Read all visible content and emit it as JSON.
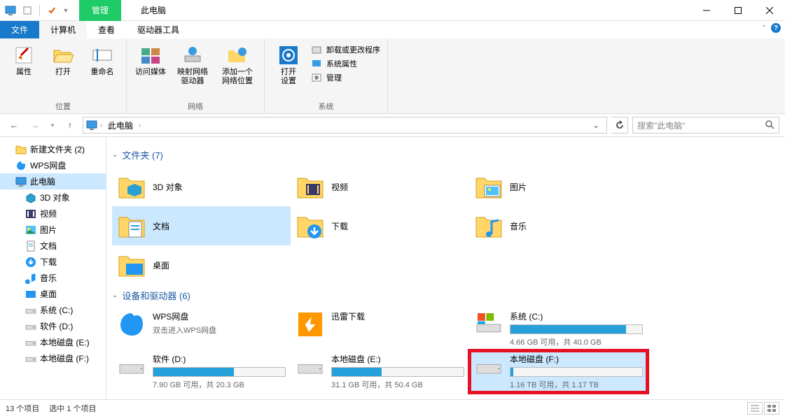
{
  "title": "此电脑",
  "context_tab": "管理",
  "ribbon_tabs": {
    "file": "文件",
    "computer": "计算机",
    "view": "查看",
    "tools": "驱动器工具"
  },
  "ribbon": {
    "group1": {
      "label": "位置",
      "properties": "属性",
      "open": "打开",
      "rename": "重命名"
    },
    "group2": {
      "label": "网络",
      "media": "访问媒体",
      "map": "映射网络\n驱动器",
      "addloc": "添加一个\n网络位置"
    },
    "group3": {
      "label": "系统",
      "settings": "打开\n设置",
      "uninstall": "卸载或更改程序",
      "sysprops": "系统属性",
      "manage": "管理"
    }
  },
  "nav": {
    "location": "此电脑",
    "search_ph": "搜索\"此电脑\""
  },
  "sidebar": {
    "items": [
      {
        "label": "新建文件夹 (2)",
        "icon": "folder"
      },
      {
        "label": "WPS网盘",
        "icon": "wps"
      },
      {
        "label": "此电脑",
        "icon": "pc",
        "selected": true
      },
      {
        "label": "3D 对象",
        "icon": "3d",
        "level": 2
      },
      {
        "label": "视频",
        "icon": "video",
        "level": 2
      },
      {
        "label": "图片",
        "icon": "pictures",
        "level": 2
      },
      {
        "label": "文档",
        "icon": "documents",
        "level": 2
      },
      {
        "label": "下载",
        "icon": "downloads",
        "level": 2
      },
      {
        "label": "音乐",
        "icon": "music",
        "level": 2
      },
      {
        "label": "桌面",
        "icon": "desktop",
        "level": 2
      },
      {
        "label": "系统 (C:)",
        "icon": "drive",
        "level": 2
      },
      {
        "label": "软件 (D:)",
        "icon": "drive",
        "level": 2
      },
      {
        "label": "本地磁盘 (E:)",
        "icon": "drive",
        "level": 2
      },
      {
        "label": "本地磁盘 (F:)",
        "icon": "drive",
        "level": 2
      }
    ]
  },
  "main": {
    "folders_header": "文件夹 (7)",
    "folders": [
      {
        "label": "3D 对象",
        "icon": "3d"
      },
      {
        "label": "视频",
        "icon": "video"
      },
      {
        "label": "图片",
        "icon": "pictures"
      },
      {
        "label": "文档",
        "icon": "documents",
        "selected": true
      },
      {
        "label": "下载",
        "icon": "downloads"
      },
      {
        "label": "音乐",
        "icon": "music"
      },
      {
        "label": "桌面",
        "icon": "desktop"
      }
    ],
    "drives_header": "设备和驱动器 (6)",
    "drives": [
      {
        "name": "WPS网盘",
        "sub": "双击进入WPS网盘",
        "icon": "wps",
        "no_bar": true
      },
      {
        "name": "迅雷下载",
        "sub": "",
        "icon": "xunlei",
        "no_bar": true
      },
      {
        "name": "系统 (C:)",
        "sub": "4.66 GB 可用，共 40.0 GB",
        "icon": "drive-win",
        "fill": 88
      },
      {
        "name": "软件 (D:)",
        "sub": "7.90 GB 可用，共 20.3 GB",
        "icon": "drive",
        "fill": 61
      },
      {
        "name": "本地磁盘 (E:)",
        "sub": "31.1 GB 可用，共 50.4 GB",
        "icon": "drive",
        "fill": 38
      },
      {
        "name": "本地磁盘 (F:)",
        "sub": "1.16 TB 可用，共 1.17 TB",
        "icon": "drive",
        "fill": 2,
        "highlighted": true,
        "selected": true
      }
    ]
  },
  "status": {
    "count": "13 个项目",
    "selected": "选中 1 个项目"
  }
}
